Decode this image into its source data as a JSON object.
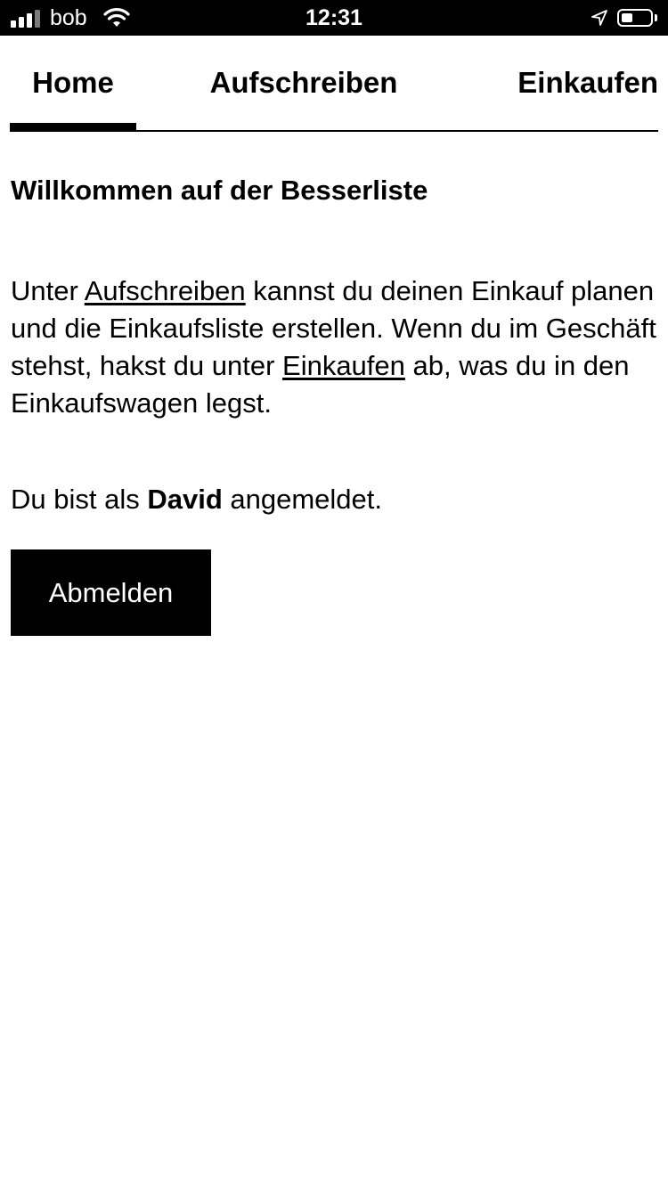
{
  "status_bar": {
    "carrier": "bob",
    "time": "12:31",
    "icons": [
      "signal-icon",
      "wifi-icon",
      "location-arrow-icon",
      "battery-icon"
    ]
  },
  "tabs": [
    {
      "label": "Home",
      "active": true
    },
    {
      "label": "Aufschreiben",
      "active": false
    },
    {
      "label": "Einkaufen",
      "active": false
    }
  ],
  "main": {
    "title": "Willkommen auf der Besserliste",
    "intro": {
      "part1": "Unter ",
      "link1": "Aufschreiben",
      "part2": " kannst du deinen Einkauf planen und die Einkaufsliste erstellen. Wenn du im Geschäft stehst, hakst du unter ",
      "link2": "Einkaufen",
      "part3": " ab, was du in den Einkaufswagen legst."
    },
    "login": {
      "prefix": "Du bist als ",
      "user": "David",
      "suffix": " angemeldet."
    },
    "logout_label": "Abmelden"
  },
  "colors": {
    "background": "#ffffff",
    "foreground": "#000000",
    "status_bar": "#000000"
  }
}
